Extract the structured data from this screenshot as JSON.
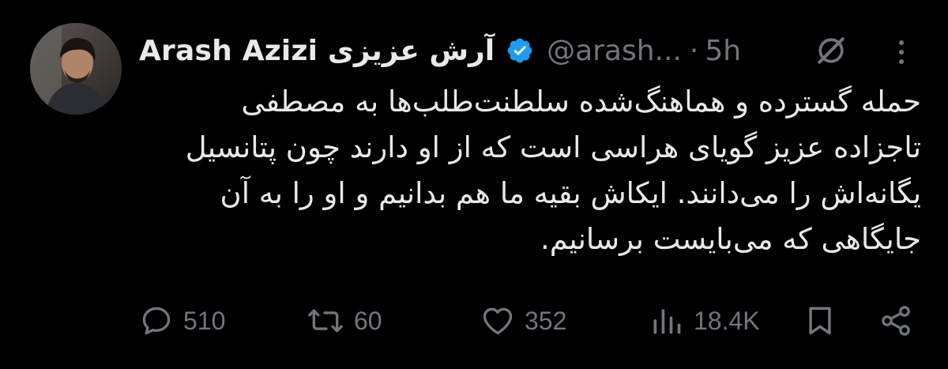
{
  "author": {
    "display_name": "Arash Azizi آرش عزیزی",
    "handle": "@arash...",
    "separator": "·",
    "time": "5h",
    "verified": true,
    "verified_color": "#1d9bf0"
  },
  "tweet": {
    "lines": [
      "حمله گسترده و هماهنگ‌شده سلطنت‌طلب‌ها به مصطفی",
      "تاجزاده عزیز گویای هراسی است که از او دارند چون پتانسیل",
      "یگانه‌اش را می‌دانند. ایکاش بقیه ما هم بدانیم و او را به آن",
      "جایگاهی که می‌بایست برسانیم."
    ]
  },
  "actions": {
    "replies": "510",
    "retweets": "60",
    "likes": "352",
    "views": "18.4K"
  },
  "icons": {
    "grok": "grok-icon",
    "more": "more-icon",
    "reply": "reply-icon",
    "retweet": "retweet-icon",
    "like": "heart-icon",
    "views": "views-icon",
    "bookmark": "bookmark-icon",
    "share": "share-icon"
  },
  "colors": {
    "background": "#000000",
    "text": "#e7e9ea",
    "secondary": "#71767b",
    "accent": "#1d9bf0"
  }
}
